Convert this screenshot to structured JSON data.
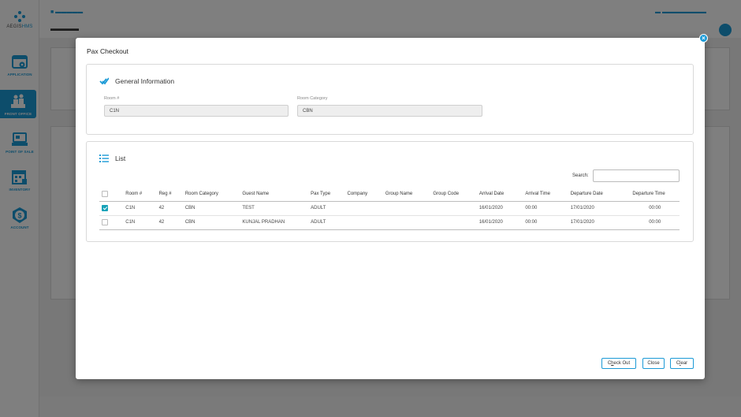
{
  "sidebar": {
    "logo": {
      "prefix": "AEGIS",
      "suffix": "HMS"
    },
    "items": [
      {
        "label": "APPLICATION",
        "icon": "application-gear-icon"
      },
      {
        "label": "FRONT OFFICE",
        "icon": "front-office-desk-icon",
        "active": true
      },
      {
        "label": "POINT OF SALE",
        "icon": "point-of-sale-icon"
      },
      {
        "label": "INVENTORY",
        "icon": "inventory-grid-icon"
      },
      {
        "label": "ACCOUNT",
        "icon": "account-dollar-icon"
      }
    ]
  },
  "modal": {
    "title": "Pax Checkout",
    "general_info": {
      "heading": "General Information",
      "room_label": "Room #",
      "room_value": "C1N",
      "category_label": "Room Category",
      "category_value": "CBN"
    },
    "list": {
      "heading": "List",
      "search_label": "Search:",
      "search_value": "",
      "columns": [
        "Room #",
        "Reg #",
        "Room Category",
        "Guest Name",
        "Pax Type",
        "Company",
        "Group Name",
        "Group Code",
        "Arrival Date",
        "Arrival Time",
        "Departure Date",
        "Departure Time"
      ],
      "rows": [
        {
          "checked": true,
          "room": "C1N",
          "reg": "42",
          "category": "CBN",
          "guest": "TEST",
          "pax_type": "ADULT",
          "company": "",
          "group_name": "",
          "group_code": "",
          "arrival_date": "16/01/2020",
          "arrival_time": "00:00",
          "departure_date": "17/01/2020",
          "departure_time": "00:00"
        },
        {
          "checked": false,
          "room": "C1N",
          "reg": "42",
          "category": "CBN",
          "guest": "KUNJAL PRADHAN",
          "pax_type": "ADULT",
          "company": "",
          "group_name": "",
          "group_code": "",
          "arrival_date": "16/01/2020",
          "arrival_time": "00:00",
          "departure_date": "17/01/2020",
          "departure_time": "00:00"
        }
      ]
    },
    "buttons": {
      "checkout": {
        "pre": "C",
        "under": "h",
        "post": "eck Out"
      },
      "close": "Close",
      "clear": {
        "pre": "C",
        "under": "l",
        "post": "ear"
      }
    }
  },
  "colors": {
    "accent": "#1b9ad6",
    "checkbox": "#17a2b8",
    "overlay": "rgba(0,0,0,0.5)"
  }
}
